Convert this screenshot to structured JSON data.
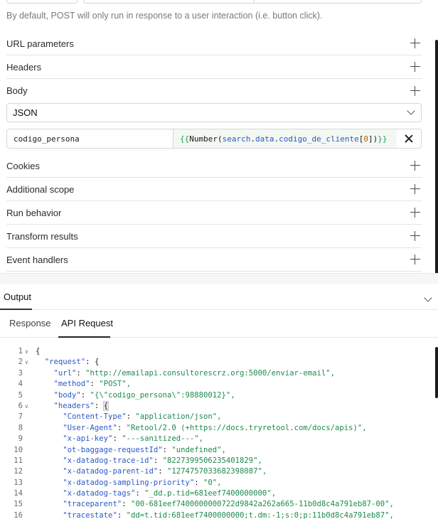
{
  "note": "By default, POST will only run in response to a user interaction (i.e. button click).",
  "sections": {
    "url_parameters": "URL parameters",
    "headers": "Headers",
    "body": "Body",
    "cookies": "Cookies",
    "additional_scope": "Additional scope",
    "run_behavior": "Run behavior",
    "transform_results": "Transform results",
    "event_handlers": "Event handlers"
  },
  "body_type": {
    "selected": "JSON"
  },
  "body_param": {
    "key": "codigo_persona",
    "value_parts": {
      "open": "{{",
      "fn": " Number(",
      "p1": "search",
      "dot1": ".",
      "p2": "data",
      "dot2": ".",
      "p3": "codigo_de_cliente",
      "lb": "[",
      "idx": "0",
      "rb": "])",
      "close": " }}"
    }
  },
  "output": {
    "title": "Output"
  },
  "tabs": {
    "response": "Response",
    "api_request": "API Request",
    "active": "API Request"
  },
  "code_lines": [
    {
      "n": "1",
      "fold": true,
      "indent": "",
      "key": "",
      "sep": "",
      "val": "{"
    },
    {
      "n": "2",
      "fold": true,
      "indent": "  ",
      "key": "\"request\"",
      "sep": ": ",
      "val": "{"
    },
    {
      "n": "3",
      "fold": false,
      "indent": "    ",
      "key": "\"url\"",
      "sep": ": ",
      "val": "\"http://emailapi.consultorescrz.org:5000/enviar-email\",",
      "str": true
    },
    {
      "n": "4",
      "fold": false,
      "indent": "    ",
      "key": "\"method\"",
      "sep": ": ",
      "val": "\"POST\",",
      "str": true
    },
    {
      "n": "5",
      "fold": false,
      "indent": "    ",
      "key": "\"body\"",
      "sep": ": ",
      "val": "\"{\\\"codigo_persona\\\":98880012}\",",
      "str": true
    },
    {
      "n": "6",
      "fold": true,
      "indent": "    ",
      "key": "\"headers\"",
      "sep": ": ",
      "val": "{",
      "hl": true
    },
    {
      "n": "7",
      "fold": false,
      "indent": "      ",
      "key": "\"Content-Type\"",
      "sep": ": ",
      "val": "\"application/json\",",
      "str": true
    },
    {
      "n": "8",
      "fold": false,
      "indent": "      ",
      "key": "\"User-Agent\"",
      "sep": ": ",
      "val": "\"Retool/2.0 (+https://docs.tryretool.com/docs/apis)\",",
      "str": true
    },
    {
      "n": "9",
      "fold": false,
      "indent": "      ",
      "key": "\"x-api-key\"",
      "sep": ": ",
      "val": "\"---sanitized---\",",
      "str": true
    },
    {
      "n": "10",
      "fold": false,
      "indent": "      ",
      "key": "\"ot-baggage-requestId\"",
      "sep": ": ",
      "val": "\"undefined\",",
      "str": true
    },
    {
      "n": "11",
      "fold": false,
      "indent": "      ",
      "key": "\"x-datadog-trace-id\"",
      "sep": ": ",
      "val": "\"8227399506235401829\",",
      "str": true
    },
    {
      "n": "12",
      "fold": false,
      "indent": "      ",
      "key": "\"x-datadog-parent-id\"",
      "sep": ": ",
      "val": "\"1274757033682398087\",",
      "str": true
    },
    {
      "n": "13",
      "fold": false,
      "indent": "      ",
      "key": "\"x-datadog-sampling-priority\"",
      "sep": ": ",
      "val": "\"0\",",
      "str": true
    },
    {
      "n": "14",
      "fold": false,
      "indent": "      ",
      "key": "\"x-datadog-tags\"",
      "sep": ": ",
      "val": "\"_dd.p.tid=681eef7400000000\",",
      "str": true
    },
    {
      "n": "15",
      "fold": false,
      "indent": "      ",
      "key": "\"traceparent\"",
      "sep": ": ",
      "val": "\"00-681eef7400000000722d9842a262a665-11b0d8c4a791eb87-00\",",
      "str": true
    },
    {
      "n": "16",
      "fold": false,
      "indent": "      ",
      "key": "\"tracestate\"",
      "sep": ": ",
      "val": "\"dd=t.tid:681eef7400000000;t.dm:-1;s:0;p:11b0d8c4a791eb87\",",
      "str": true
    }
  ]
}
